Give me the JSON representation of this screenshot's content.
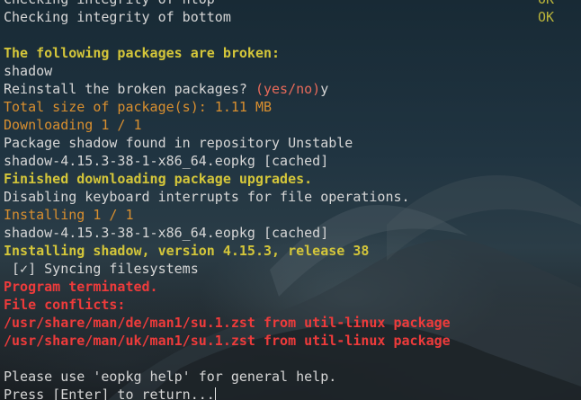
{
  "terminal": {
    "lines": [
      {
        "text": "Checking integrity of htop",
        "status": "OK"
      },
      {
        "text": "Checking integrity of bottom",
        "status": "OK"
      },
      {
        "text": ""
      },
      {
        "text": "The following packages are broken:"
      },
      {
        "text": "shadow"
      },
      {
        "text": "Reinstall the broken packages? ",
        "prompt": "(yes/no)",
        "answer": "y"
      },
      {
        "text": "Total size of package(s): 1.11 MB"
      },
      {
        "text": "Downloading 1 / 1"
      },
      {
        "text": "Package shadow found in repository Unstable"
      },
      {
        "text": "shadow-4.15.3-38-1-x86_64.eopkg [cached]"
      },
      {
        "text": "Finished downloading package upgrades."
      },
      {
        "text": "Disabling keyboard interrupts for file operations."
      },
      {
        "text": "Installing 1 / 1"
      },
      {
        "text": "shadow-4.15.3-38-1-x86_64.eopkg [cached]"
      },
      {
        "text": "Installing shadow, version 4.15.3, release 38"
      },
      {
        "text": " [✓] Syncing filesystems"
      },
      {
        "text": "Program terminated."
      },
      {
        "text": "File conflicts:"
      },
      {
        "text": "/usr/share/man/de/man1/su.1.zst from util-linux package"
      },
      {
        "text": "/usr/share/man/uk/man1/su.1.zst from util-linux package"
      },
      {
        "text": ""
      },
      {
        "text": "Please use 'eopkg help' for general help."
      },
      {
        "text": "Press [Enter] to return..."
      }
    ]
  },
  "colors": {
    "default_text": "#d6d6d6",
    "heading_yellow": "#d4c63a",
    "info_orange": "#d98f2f",
    "error_red": "#ee3b3b",
    "status_ok": "#b9b43a",
    "prompt_choice": "#e86a5a"
  }
}
